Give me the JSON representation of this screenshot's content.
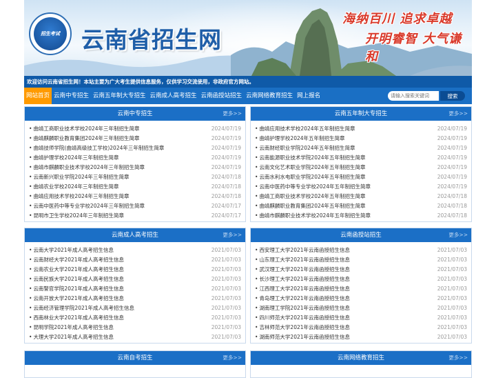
{
  "banner": {
    "logo_text": "招生考试",
    "title": "云南省招生网",
    "slogan1": "海纳百川  追求卓越",
    "slogan2": "开明睿智  大气谦和"
  },
  "welcome": "欢迎访问云南省招生网！本站主要为广大考生提供信息服务，仅供学习交流使用，非政府官方网站。",
  "nav": {
    "items": [
      "网站首页",
      "云南中专招生",
      "云南五年制大专招生",
      "云南成人高考招生",
      "云南函授站招生",
      "云南网络教育招生",
      "网上报名"
    ],
    "search_placeholder": "请输入搜索关键词",
    "search_button": "搜索"
  },
  "more_label": "更多>>",
  "panels": [
    {
      "title": "云南中专招生",
      "items": [
        {
          "t": "曲靖工商职业技术学校2024年三年制招生简章",
          "d": "2024/07/19"
        },
        {
          "t": "曲靖麒麟职业教育集团2024年三年制招生简章",
          "d": "2024/07/19"
        },
        {
          "t": "曲靖技师学院(曲靖高级技工学校)2024年三年制招生简章",
          "d": "2024/07/19"
        },
        {
          "t": "曲靖护理学校2024年三年制招生简章",
          "d": "2024/07/19"
        },
        {
          "t": "曲靖市麒麟职业技术学校2024年三年制招生简章",
          "d": "2024/07/19"
        },
        {
          "t": "云南新兴职业学院2024年三年制招生简章",
          "d": "2024/07/18"
        },
        {
          "t": "曲靖农业学校2024年三年制招生简章",
          "d": "2024/07/18"
        },
        {
          "t": "曲靖应用技术学校2024年三年制招生简章",
          "d": "2024/07/18"
        },
        {
          "t": "云南中医药中等专业学校2024年三年制招生简章",
          "d": "2024/07/17"
        },
        {
          "t": "昆明市卫生学校2024年三年制招生简章",
          "d": "2024/07/17"
        }
      ]
    },
    {
      "title": "云南五年制大专招生",
      "items": [
        {
          "t": "曲靖应用技术学校2024年五年制招生简章",
          "d": "2024/07/19"
        },
        {
          "t": "曲靖护理学校2024年五年制招生简章",
          "d": "2024/07/19"
        },
        {
          "t": "云南财经职业学院2024年五年制招生简章",
          "d": "2024/07/19"
        },
        {
          "t": "云南能源职业技术学院2024年五年制招生简章",
          "d": "2024/07/19"
        },
        {
          "t": "云南文化艺术职业学院2024年五年制招生简章",
          "d": "2024/07/19"
        },
        {
          "t": "云南水利水电职业学院2024年五年制招生简章",
          "d": "2024/07/19"
        },
        {
          "t": "云南中医药中等专业学校2024年五年制招生简章",
          "d": "2024/07/19"
        },
        {
          "t": "曲靖工商职业技术学校2024年五年制招生简章",
          "d": "2024/07/18"
        },
        {
          "t": "曲靖麒麟职业教育集团2024年五年制招生简章",
          "d": "2024/07/18"
        },
        {
          "t": "曲靖市麒麟职业技术学校2024年五年制招生简章",
          "d": "2024/07/18"
        }
      ]
    },
    {
      "title": "云南成人高考招生",
      "items": [
        {
          "t": "云南大学2021年成人高考招生信息",
          "d": "2021/07/03"
        },
        {
          "t": "云南财经大学2021年成人高考招生信息",
          "d": "2021/07/03"
        },
        {
          "t": "云南农业大学2021年成人高考招生信息",
          "d": "2021/07/03"
        },
        {
          "t": "云南民族大学2021年成人高考招生信息",
          "d": "2021/07/03"
        },
        {
          "t": "云南警官学院2021年成人高考招生信息",
          "d": "2021/07/03"
        },
        {
          "t": "云南开放大学2021年成人高考招生信息",
          "d": "2021/07/03"
        },
        {
          "t": "云南经济管理学院2021年成人高考招生信息",
          "d": "2021/07/03"
        },
        {
          "t": "西南林业大学2021年成人高考招生信息",
          "d": "2021/07/03"
        },
        {
          "t": "昆明学院2021年成人高考招生信息",
          "d": "2021/07/03"
        },
        {
          "t": "大理大学2021年成人高考招生信息",
          "d": "2021/07/03"
        }
      ]
    },
    {
      "title": "云南函授站招生",
      "items": [
        {
          "t": "西安理工大学2021年云南函授招生信息",
          "d": "2021/07/03"
        },
        {
          "t": "山东理工大学2021年云南函授招生信息",
          "d": "2021/07/03"
        },
        {
          "t": "武汉理工大学2021年云南函授招生信息",
          "d": "2021/07/03"
        },
        {
          "t": "长沙理工大学2021年云南函授招生信息",
          "d": "2021/07/03"
        },
        {
          "t": "江西理工大学2021年云南函授招生信息",
          "d": "2021/07/03"
        },
        {
          "t": "青岛理工大学2021年云南函授招生信息",
          "d": "2021/07/03"
        },
        {
          "t": "湖南理工学院2021年云南函授招生信息",
          "d": "2021/07/03"
        },
        {
          "t": "四川师范大学2021年云南函授招生信息",
          "d": "2021/07/03"
        },
        {
          "t": "吉林师范大学2021年云南函授招生信息",
          "d": "2021/07/03"
        },
        {
          "t": "湖南师范大学2021年云南函授招生信息",
          "d": "2021/07/03"
        }
      ]
    },
    {
      "title": "云南自考招生",
      "items": []
    },
    {
      "title": "云南网络教育招生",
      "items": []
    }
  ]
}
